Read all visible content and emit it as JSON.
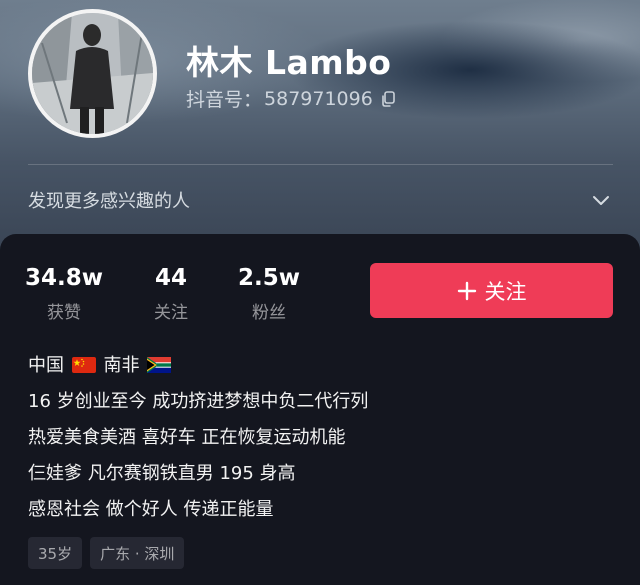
{
  "profile": {
    "name": "林木 Lambo",
    "id_label": "抖音号",
    "id_separator": "：",
    "id_value": "587971096",
    "copy_icon": "copy-icon"
  },
  "discover": {
    "label": "发现更多感兴趣的人",
    "icon": "chevron-down-icon"
  },
  "stats": [
    {
      "value": "34.8w",
      "label": "获赞"
    },
    {
      "value": "44",
      "label": "关注"
    },
    {
      "value": "2.5w",
      "label": "粉丝"
    }
  ],
  "follow_button": {
    "icon": "plus-icon",
    "label": "关注",
    "color": "#ef3c57"
  },
  "bio": {
    "line1_a": "中国",
    "line1_flag_a": "china-flag-icon",
    "line1_b": "南非",
    "line1_flag_b": "south-africa-flag-icon",
    "lines": [
      "16 岁创业至今 成功挤进梦想中负二代行列",
      "热爱美食美酒 喜好车 正在恢复运动机能",
      "仨娃爹  凡尔赛钢铁直男 195 身高",
      "感恩社会 做个好人 传递正能量"
    ]
  },
  "tags": [
    "35岁",
    "广东 · 深圳"
  ]
}
